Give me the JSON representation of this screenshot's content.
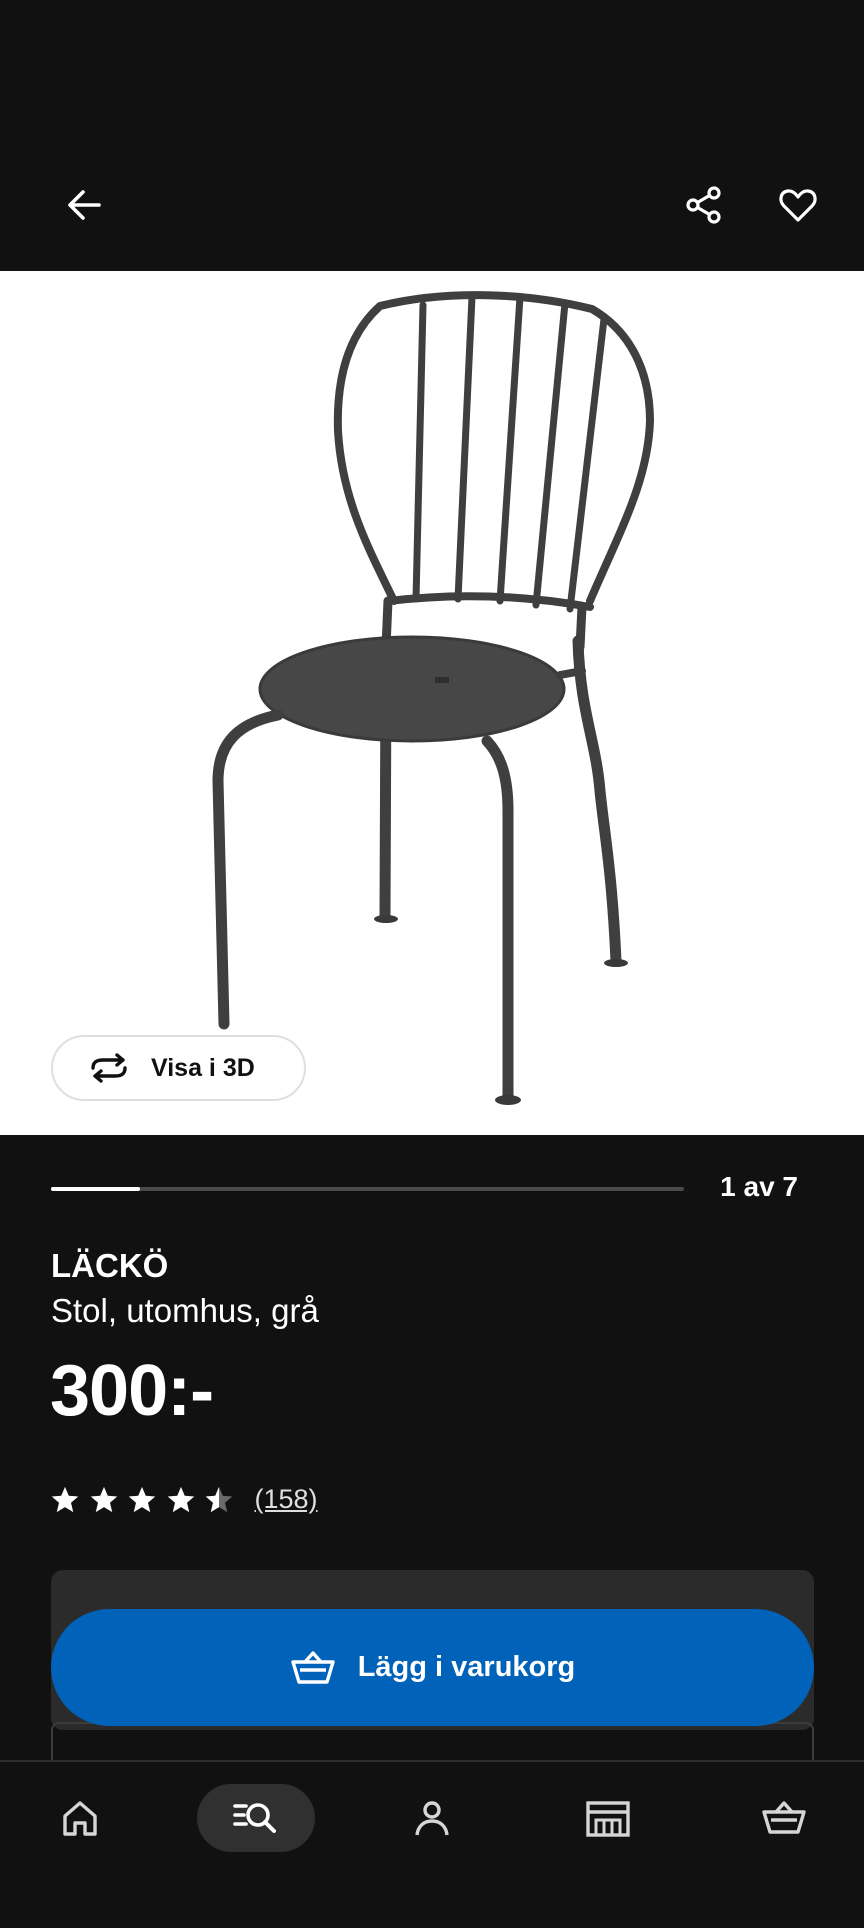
{
  "header": {
    "back_icon": "arrow-left-icon",
    "share_icon": "share-icon",
    "favorite_icon": "heart-icon"
  },
  "gallery": {
    "view_3d_label": "Visa i 3D",
    "view_3d_icon": "rotate-3d-icon",
    "counter": "1 av 7",
    "progress": 0.14
  },
  "product": {
    "name": "LÄCKÖ",
    "description": "Stol, utomhus, grå",
    "price": "300:-",
    "rating": 4.5,
    "rating_max": 5,
    "review_count": "(158)"
  },
  "cart_button": {
    "label": "Lägg i varukorg",
    "icon": "basket-icon",
    "color": "#0062b8"
  },
  "bottom_nav": {
    "items": [
      {
        "icon": "home-icon",
        "active": false
      },
      {
        "icon": "search-icon",
        "active": true
      },
      {
        "icon": "profile-icon",
        "active": false
      },
      {
        "icon": "store-icon",
        "active": false
      },
      {
        "icon": "basket-icon",
        "active": false
      }
    ]
  },
  "colors": {
    "background": "#111111",
    "accent": "#0062b8",
    "surface": "#2b2b2b"
  }
}
